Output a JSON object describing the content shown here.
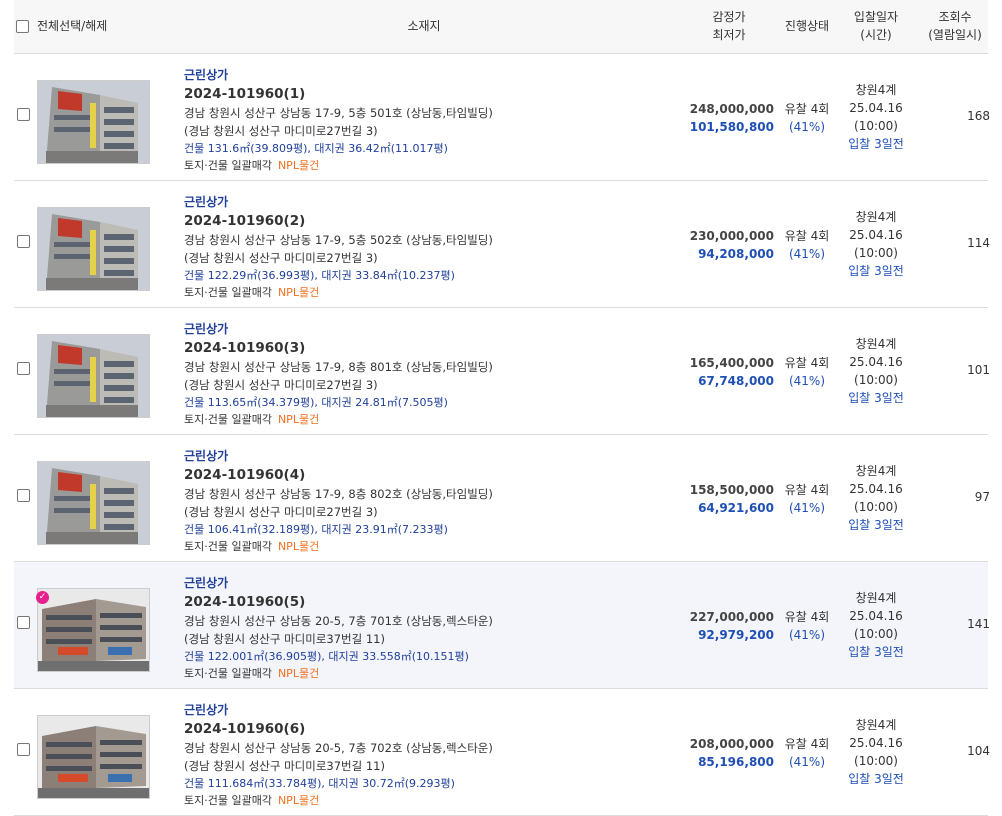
{
  "header": {
    "select_all": "전체선택/해제",
    "location": "소재지",
    "price_line1": "감정가",
    "price_line2": "최저가",
    "status": "진행상태",
    "date_line1": "입찰일자",
    "date_line2": "(시간)",
    "views_line1": "조회수",
    "views_line2": "(열람일시)"
  },
  "colors": {
    "accent": "#1f4fb4",
    "npl": "#f07020",
    "selected_row": "#f4f5fa",
    "badge": "#e6208d"
  },
  "rows": [
    {
      "category": "근린상가",
      "case_no": "2024-101960(1)",
      "address": "경남 창원시 성산구 상남동 17-9, 5층 501호 (상남동,타임빌딩)",
      "road_address": "(경남 창원시 성산구 마디미로27번길 3)",
      "area": "건물 131.6㎡(39.809평), 대지권 36.42㎡(11.017평)",
      "tag_sale": "토지·건물 일괄매각",
      "tag_npl": "NPL물건",
      "appraisal": "248,000,000",
      "minimum": "101,580,800",
      "status": "유찰 4회",
      "ratio": "(41%)",
      "court": "창원4계",
      "date": "25.04.16",
      "time": "(10:00)",
      "dday": "입찰 3일전",
      "views": "168",
      "image": "building-photo-taim",
      "checked_badge": false
    },
    {
      "category": "근린상가",
      "case_no": "2024-101960(2)",
      "address": "경남 창원시 성산구 상남동 17-9, 5층 502호 (상남동,타임빌딩)",
      "road_address": "(경남 창원시 성산구 마디미로27번길 3)",
      "area": "건물 122.29㎡(36.993평), 대지권 33.84㎡(10.237평)",
      "tag_sale": "토지·건물 일괄매각",
      "tag_npl": "NPL물건",
      "appraisal": "230,000,000",
      "minimum": "94,208,000",
      "status": "유찰 4회",
      "ratio": "(41%)",
      "court": "창원4계",
      "date": "25.04.16",
      "time": "(10:00)",
      "dday": "입찰 3일전",
      "views": "114",
      "image": "building-photo-taim",
      "checked_badge": false
    },
    {
      "category": "근린상가",
      "case_no": "2024-101960(3)",
      "address": "경남 창원시 성산구 상남동 17-9, 8층 801호 (상남동,타임빌딩)",
      "road_address": "(경남 창원시 성산구 마디미로27번길 3)",
      "area": "건물 113.65㎡(34.379평), 대지권 24.81㎡(7.505평)",
      "tag_sale": "토지·건물 일괄매각",
      "tag_npl": "NPL물건",
      "appraisal": "165,400,000",
      "minimum": "67,748,000",
      "status": "유찰 4회",
      "ratio": "(41%)",
      "court": "창원4계",
      "date": "25.04.16",
      "time": "(10:00)",
      "dday": "입찰 3일전",
      "views": "101",
      "image": "building-photo-taim",
      "checked_badge": false
    },
    {
      "category": "근린상가",
      "case_no": "2024-101960(4)",
      "address": "경남 창원시 성산구 상남동 17-9, 8층 802호 (상남동,타임빌딩)",
      "road_address": "(경남 창원시 성산구 마디미로27번길 3)",
      "area": "건물 106.41㎡(32.189평), 대지권 23.91㎡(7.233평)",
      "tag_sale": "토지·건물 일괄매각",
      "tag_npl": "NPL물건",
      "appraisal": "158,500,000",
      "minimum": "64,921,600",
      "status": "유찰 4회",
      "ratio": "(41%)",
      "court": "창원4계",
      "date": "25.04.16",
      "time": "(10:00)",
      "dday": "입찰 3일전",
      "views": "97",
      "image": "building-photo-taim",
      "checked_badge": false
    },
    {
      "category": "근린상가",
      "case_no": "2024-101960(5)",
      "address": "경남 창원시 성산구 상남동 20-5, 7층 701호 (상남동,렉스타운)",
      "road_address": "(경남 창원시 성산구 마디미로37번길 11)",
      "area": "건물 122.001㎡(36.905평), 대지권 33.558㎡(10.151평)",
      "tag_sale": "토지·건물 일괄매각",
      "tag_npl": "NPL물건",
      "appraisal": "227,000,000",
      "minimum": "92,979,200",
      "status": "유찰 4회",
      "ratio": "(41%)",
      "court": "창원4계",
      "date": "25.04.16",
      "time": "(10:00)",
      "dday": "입찰 3일전",
      "views": "141",
      "image": "building-photo-rex",
      "checked_badge": true
    },
    {
      "category": "근린상가",
      "case_no": "2024-101960(6)",
      "address": "경남 창원시 성산구 상남동 20-5, 7층 702호 (상남동,렉스타운)",
      "road_address": "(경남 창원시 성산구 마디미로37번길 11)",
      "area": "건물 111.684㎡(33.784평), 대지권 30.72㎡(9.293평)",
      "tag_sale": "토지·건물 일괄매각",
      "tag_npl": "NPL물건",
      "appraisal": "208,000,000",
      "minimum": "85,196,800",
      "status": "유찰 4회",
      "ratio": "(41%)",
      "court": "창원4계",
      "date": "25.04.16",
      "time": "(10:00)",
      "dday": "입찰 3일전",
      "views": "104",
      "image": "building-photo-rex",
      "checked_badge": false
    }
  ]
}
